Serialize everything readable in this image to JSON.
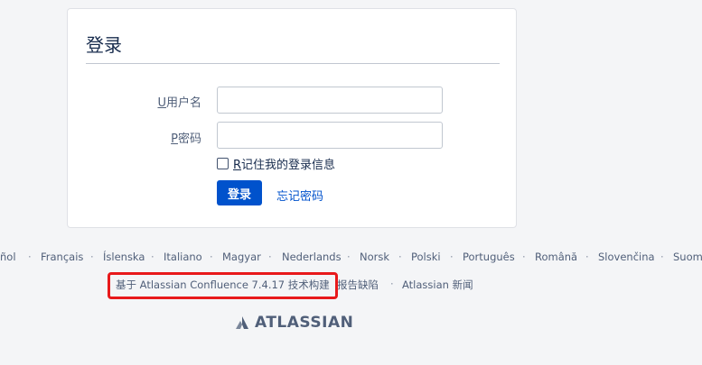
{
  "login_form": {
    "title": "登录",
    "username": {
      "accesskey": "U",
      "label": "用户名",
      "value": "",
      "placeholder": ""
    },
    "password": {
      "accesskey": "P",
      "label": "密码",
      "value": "",
      "placeholder": ""
    },
    "remember": {
      "accesskey": "R",
      "label": "记住我的登录信息",
      "checked": false
    },
    "submit_label": "登录",
    "forgot_label": "忘记密码"
  },
  "languages": [
    "ñol",
    "Français",
    "Íslenska",
    "Italiano",
    "Magyar",
    "Nederlands",
    "Norsk",
    "Polski",
    "Português",
    "Română",
    "Slovenčina",
    "Suom"
  ],
  "footer": {
    "powered_by": "基于 Atlassian Confluence 7.4.17 技术构建",
    "report_bug": "报告缺陷",
    "news": "Atlassian 新闻"
  },
  "logo": {
    "icon": "atlassian-logo-icon",
    "text": "ATLASSIAN"
  },
  "colors": {
    "primary": "#0052cc",
    "highlight": "#e8191b",
    "background": "#f4f5f7"
  }
}
